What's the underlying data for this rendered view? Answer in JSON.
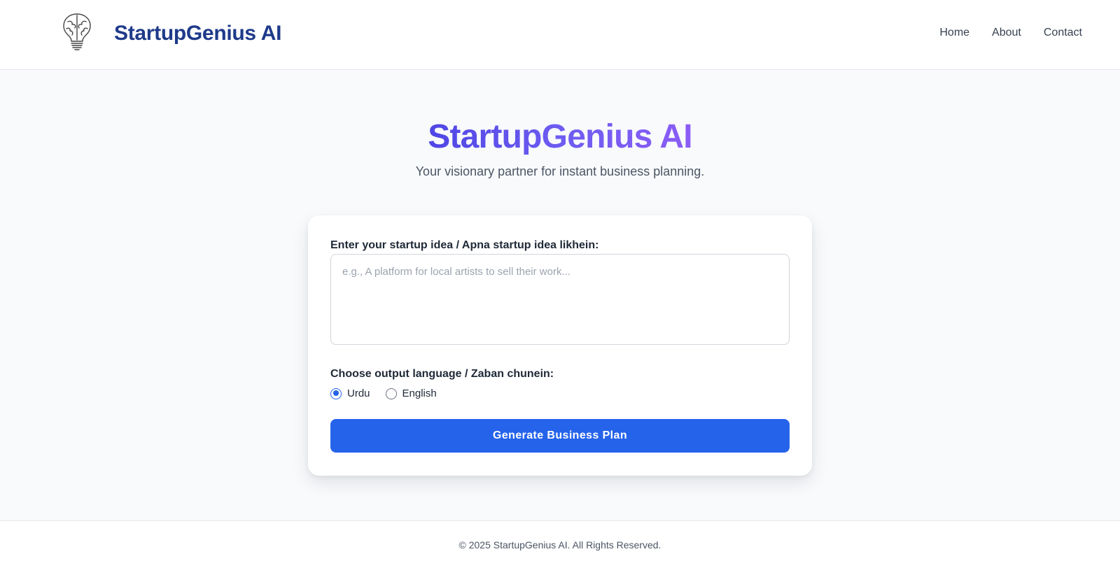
{
  "header": {
    "logo_icon": "brain-lightbulb-icon",
    "brand": "StartupGenius AI",
    "nav": [
      {
        "label": "Home"
      },
      {
        "label": "About"
      },
      {
        "label": "Contact"
      }
    ]
  },
  "hero": {
    "title": "StartupGenius AI",
    "subtitle": "Your visionary partner for instant business planning."
  },
  "form": {
    "idea_label": "Enter your startup idea / Apna startup idea likhein:",
    "idea_value": "",
    "idea_placeholder": "e.g., A platform for local artists to sell their work...",
    "language_label": "Choose output language / Zaban chunein:",
    "languages": [
      {
        "label": "Urdu",
        "checked": true
      },
      {
        "label": "English",
        "checked": false
      }
    ],
    "generate_label": "Generate Business Plan"
  },
  "footer": {
    "text": "© 2025 StartupGenius AI. All Rights Reserved."
  },
  "colors": {
    "accent": "#2563eb",
    "brand": "#1e3a8a",
    "title_gradient_start": "#4f46e5",
    "title_gradient_end": "#8b5cf6"
  }
}
